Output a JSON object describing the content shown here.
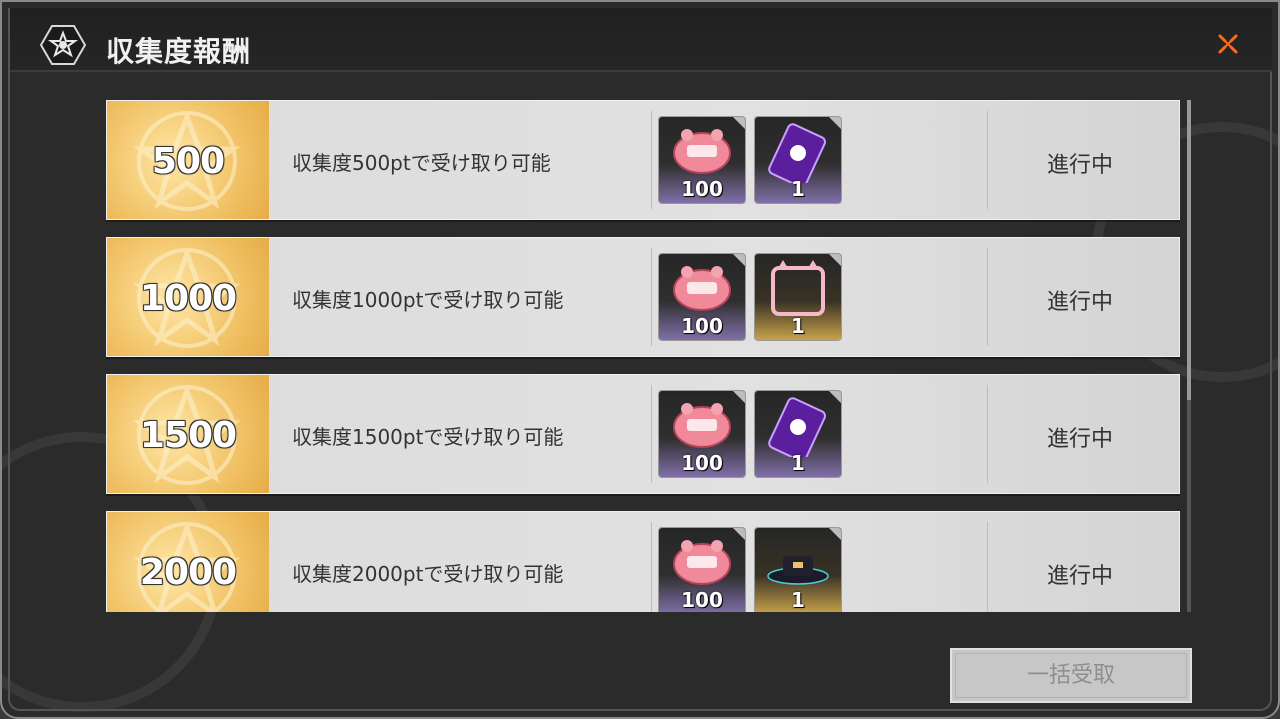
{
  "header": {
    "title": "収集度報酬"
  },
  "rewards": [
    {
      "points": "500",
      "description": "収集度500ptで受け取り可能",
      "status": "進行中",
      "items": [
        {
          "icon": "candy-ticket-icon",
          "count": "100",
          "rarity": "purple"
        },
        {
          "icon": "phone-card-icon",
          "count": "1",
          "rarity": "purple"
        }
      ]
    },
    {
      "points": "1000",
      "description": "収集度1000ptで受け取り可能",
      "status": "進行中",
      "items": [
        {
          "icon": "candy-ticket-icon",
          "count": "100",
          "rarity": "purple"
        },
        {
          "icon": "cat-frame-icon",
          "count": "1",
          "rarity": "gold"
        }
      ]
    },
    {
      "points": "1500",
      "description": "収集度1500ptで受け取り可能",
      "status": "進行中",
      "items": [
        {
          "icon": "candy-ticket-icon",
          "count": "100",
          "rarity": "purple"
        },
        {
          "icon": "phone-card-icon",
          "count": "1",
          "rarity": "purple"
        }
      ]
    },
    {
      "points": "2000",
      "description": "収集度2000ptで受け取り可能",
      "status": "進行中",
      "items": [
        {
          "icon": "candy-ticket-icon",
          "count": "100",
          "rarity": "purple"
        },
        {
          "icon": "hat-icon",
          "count": "1",
          "rarity": "gold"
        }
      ]
    }
  ],
  "footer": {
    "claim_all_label": "一括受取"
  },
  "colors": {
    "accent_close": "#ff6a1a",
    "points_gold": "#f1c266",
    "item_purple": "#806fa8",
    "item_gold": "#c9a24b"
  }
}
